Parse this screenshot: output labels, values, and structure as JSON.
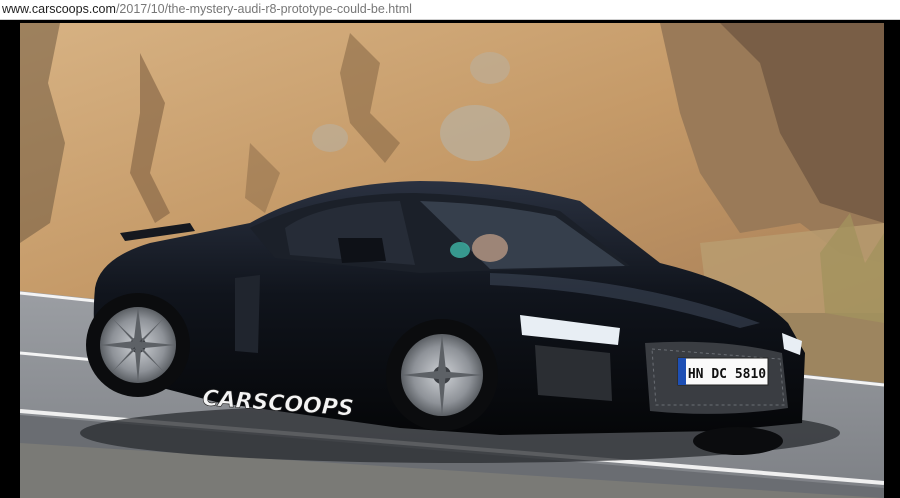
{
  "browser": {
    "url_host": "www.carscoops.com",
    "url_path": "/2017/10/the-mystery-audi-r8-prototype-could-be.html"
  },
  "photo": {
    "watermark": "CARSCOOPS",
    "license_plate": "HN DC 5810",
    "colors": {
      "rock": "#c9a070",
      "rock_shadow": "#8a6a48",
      "road": "#8e9196",
      "car_body": "#0d1016",
      "rim": "#9a9ea4",
      "page_bg": "#000000"
    }
  }
}
